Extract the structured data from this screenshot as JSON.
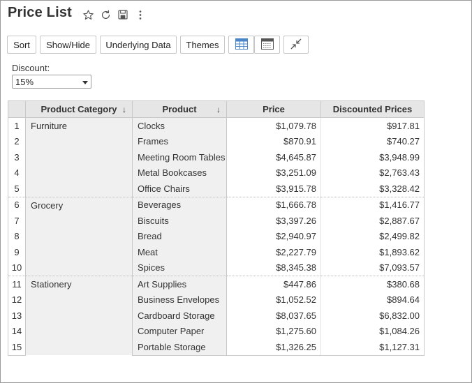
{
  "page": {
    "title": "Price List"
  },
  "toolbar": {
    "sort": "Sort",
    "show_hide": "Show/Hide",
    "underlying_data": "Underlying Data",
    "themes": "Themes"
  },
  "filter": {
    "label": "Discount:",
    "value": "15%"
  },
  "table": {
    "headers": {
      "category": "Product Category",
      "product": "Product",
      "price": "Price",
      "discounted": "Discounted Prices"
    },
    "sort_arrow": "↓",
    "groups": [
      {
        "category": "Furniture",
        "rows": [
          {
            "n": "1",
            "product": "Clocks",
            "price": "$1,079.78",
            "discounted": "$917.81"
          },
          {
            "n": "2",
            "product": "Frames",
            "price": "$870.91",
            "discounted": "$740.27"
          },
          {
            "n": "3",
            "product": "Meeting Room Tables",
            "price": "$4,645.87",
            "discounted": "$3,948.99"
          },
          {
            "n": "4",
            "product": "Metal Bookcases",
            "price": "$3,251.09",
            "discounted": "$2,763.43"
          },
          {
            "n": "5",
            "product": "Office Chairs",
            "price": "$3,915.78",
            "discounted": "$3,328.42"
          }
        ]
      },
      {
        "category": "Grocery",
        "rows": [
          {
            "n": "6",
            "product": "Beverages",
            "price": "$1,666.78",
            "discounted": "$1,416.77"
          },
          {
            "n": "7",
            "product": "Biscuits",
            "price": "$3,397.26",
            "discounted": "$2,887.67"
          },
          {
            "n": "8",
            "product": "Bread",
            "price": "$2,940.97",
            "discounted": "$2,499.82"
          },
          {
            "n": "9",
            "product": "Meat",
            "price": "$2,227.79",
            "discounted": "$1,893.62"
          },
          {
            "n": "10",
            "product": "Spices",
            "price": "$8,345.38",
            "discounted": "$7,093.57"
          }
        ]
      },
      {
        "category": "Stationery",
        "rows": [
          {
            "n": "11",
            "product": "Art Supplies",
            "price": "$447.86",
            "discounted": "$380.68"
          },
          {
            "n": "12",
            "product": "Business Envelopes",
            "price": "$1,052.52",
            "discounted": "$894.64"
          },
          {
            "n": "13",
            "product": "Cardboard Storage",
            "price": "$8,037.65",
            "discounted": "$6,832.00"
          },
          {
            "n": "14",
            "product": "Computer Paper",
            "price": "$1,275.60",
            "discounted": "$1,084.26"
          },
          {
            "n": "15",
            "product": "Portable Storage",
            "price": "$1,326.25",
            "discounted": "$1,127.31"
          }
        ]
      }
    ]
  },
  "colors": {
    "header_bg": "#e6e6e6",
    "dimension_bg": "#f0f0f0",
    "accent_blue": "#4a86c8"
  }
}
